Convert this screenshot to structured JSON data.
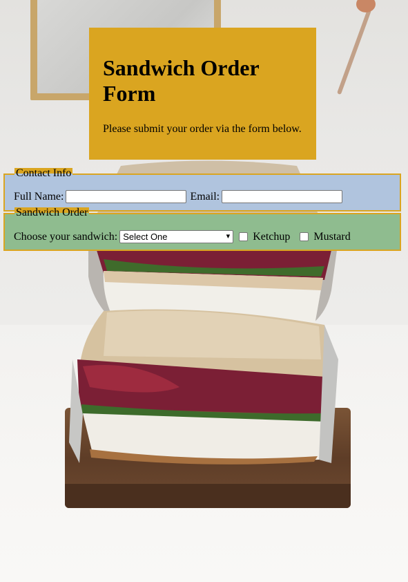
{
  "header": {
    "title": "Sandwich Order Form",
    "subtitle": "Please submit your order via the form below."
  },
  "contact": {
    "legend": "Contact Info",
    "full_name_label": "Full Name:",
    "full_name_value": "",
    "email_label": "Email:",
    "email_value": ""
  },
  "order": {
    "legend": "Sandwich Order",
    "choose_label": "Choose your sandwich:",
    "select_value": "Select One",
    "ketchup_label": "Ketchup",
    "ketchup_checked": false,
    "mustard_label": "Mustard",
    "mustard_checked": false
  },
  "colors": {
    "header_bg": "#daa520",
    "contact_bg": "#b0c4de",
    "order_bg": "#8fbc8f",
    "border": "#daa520"
  },
  "icons": {
    "select_arrow": "chevron-down-icon"
  }
}
